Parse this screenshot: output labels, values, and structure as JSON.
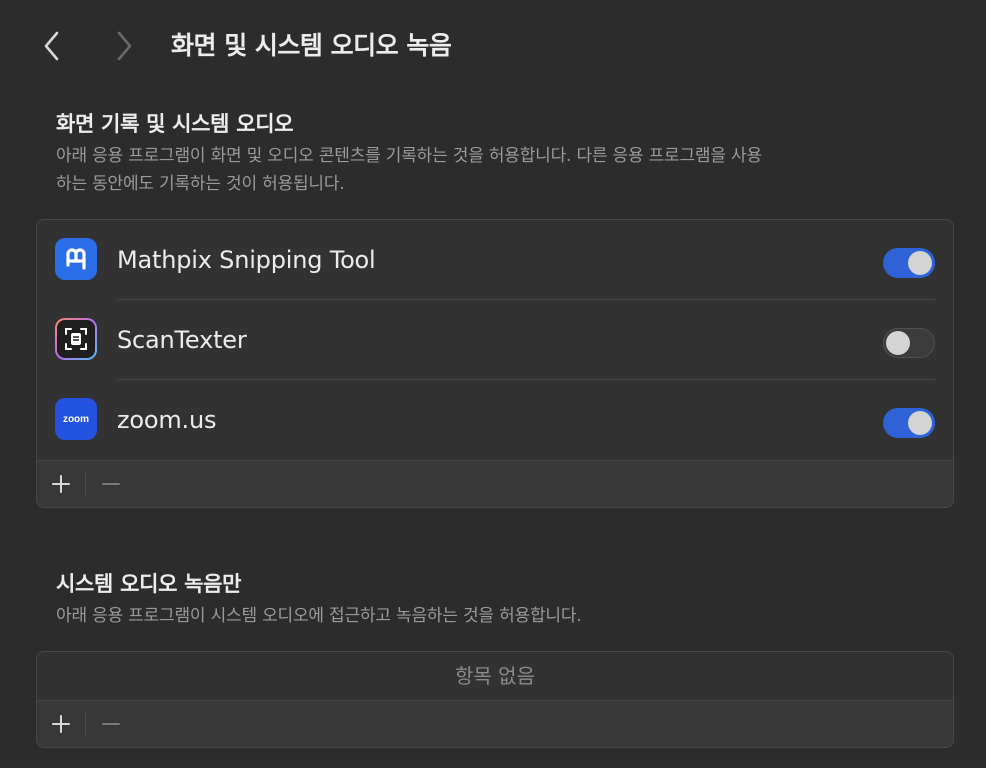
{
  "header": {
    "title": "화면 및 시스템 오디오 녹음"
  },
  "section1": {
    "title": "화면 기록 및 시스템 오디오",
    "description_line1": "아래 응용 프로그램이 화면 및 오디오 콘텐츠를 기록하는 것을 허용합니다. 다른 응용 프로그램을 사용",
    "description_line2": "하는 동안에도 기록하는 것이 허용됩니다.",
    "apps": [
      {
        "name": "Mathpix Snipping Tool",
        "enabled": true,
        "icon": "mathpix-icon"
      },
      {
        "name": "ScanTexter",
        "enabled": false,
        "icon": "scantexter-icon"
      },
      {
        "name": "zoom.us",
        "enabled": true,
        "icon": "zoom-icon",
        "icon_text": "zoom"
      }
    ]
  },
  "section2": {
    "title": "시스템 오디오 녹음만",
    "description": "아래 응용 프로그램이 시스템 오디오에 접근하고 녹음하는 것을 허용합니다.",
    "empty_text": "항목 없음"
  },
  "colors": {
    "background": "#2c2c2c",
    "toggle_on": "#2f62d6",
    "mathpix_blue": "#2b6fe8",
    "zoom_blue": "#2453e0"
  }
}
